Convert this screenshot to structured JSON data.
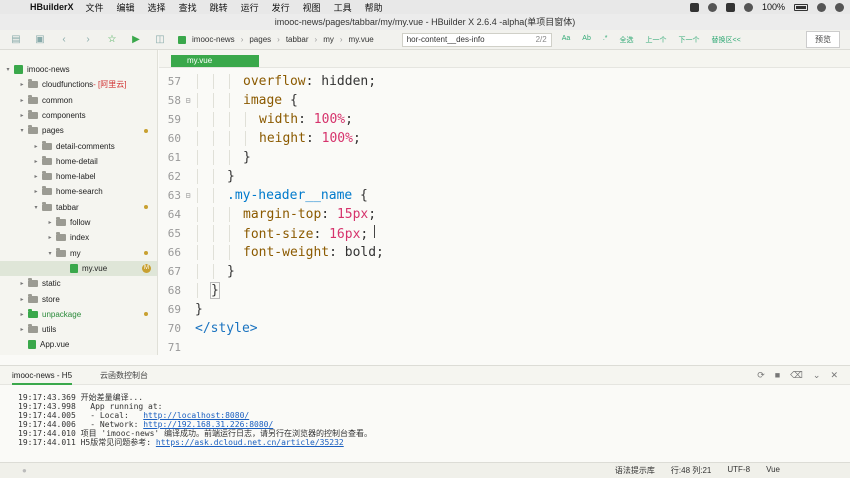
{
  "menubar": {
    "app_name": "HBuilderX",
    "items": [
      "文件",
      "编辑",
      "选择",
      "查找",
      "跳转",
      "运行",
      "发行",
      "视图",
      "工具",
      "帮助"
    ],
    "battery": "100%"
  },
  "window": {
    "title": "imooc-news/pages/tabbar/my/my.vue - HBuilder X 2.6.4 -alpha(单项目窗体)"
  },
  "toolbar": {
    "breadcrumbs": [
      "imooc-news",
      "pages",
      "tabbar",
      "my",
      "my.vue"
    ],
    "find_value": "hor-content__des-info",
    "find_count": "2/2",
    "find_actions": [
      "Aa",
      "Ab",
      ".*",
      "全选",
      "上一个",
      "下一个",
      "替换区<<"
    ],
    "preview_label": "预览"
  },
  "sidebar": {
    "items": [
      {
        "label": "imooc-news",
        "kind": "project",
        "arrow": "▾",
        "indent": 0
      },
      {
        "label": "cloudfunctions",
        "extra": " - [阿里云]",
        "kind": "folder",
        "arrow": "▸",
        "indent": 1
      },
      {
        "label": "common",
        "kind": "folder",
        "arrow": "▸",
        "indent": 1
      },
      {
        "label": "components",
        "kind": "folder",
        "arrow": "▸",
        "indent": 1
      },
      {
        "label": "pages",
        "kind": "folder",
        "arrow": "▾",
        "indent": 1,
        "modified": true
      },
      {
        "label": "detail-comments",
        "kind": "folder",
        "arrow": "▸",
        "indent": 2
      },
      {
        "label": "home-detail",
        "kind": "folder",
        "arrow": "▸",
        "indent": 2
      },
      {
        "label": "home-label",
        "kind": "folder",
        "arrow": "▸",
        "indent": 2
      },
      {
        "label": "home-search",
        "kind": "folder",
        "arrow": "▸",
        "indent": 2
      },
      {
        "label": "tabbar",
        "kind": "folder",
        "arrow": "▾",
        "indent": 2,
        "modified": true
      },
      {
        "label": "follow",
        "kind": "folder",
        "arrow": "▸",
        "indent": 3
      },
      {
        "label": "index",
        "kind": "folder",
        "arrow": "▸",
        "indent": 3
      },
      {
        "label": "my",
        "kind": "folder",
        "arrow": "▾",
        "indent": 3,
        "modified": true
      },
      {
        "label": "my.vue",
        "kind": "file",
        "arrow": "",
        "indent": 4,
        "badge": "M",
        "selected": true
      },
      {
        "label": "static",
        "kind": "folder",
        "arrow": "▸",
        "indent": 1
      },
      {
        "label": "store",
        "kind": "folder",
        "arrow": "▸",
        "indent": 1
      },
      {
        "label": "unpackage",
        "kind": "folder-green",
        "arrow": "▸",
        "indent": 1,
        "modified": true
      },
      {
        "label": "utils",
        "kind": "folder",
        "arrow": "▸",
        "indent": 1
      },
      {
        "label": "App.vue",
        "kind": "file",
        "arrow": "",
        "indent": 1
      }
    ]
  },
  "editor": {
    "tab_label": "my.vue",
    "lines": [
      {
        "n": "57",
        "indent": 3,
        "parts": [
          [
            "prop",
            "overflow"
          ],
          [
            "val",
            ": hidden;"
          ]
        ]
      },
      {
        "n": "58",
        "indent": 3,
        "fold": "⊟",
        "parts": [
          [
            "sel",
            "image"
          ],
          [
            "val",
            " {"
          ]
        ]
      },
      {
        "n": "59",
        "indent": 4,
        "parts": [
          [
            "prop",
            "width"
          ],
          [
            "val",
            ": "
          ],
          [
            "num",
            "100"
          ],
          [
            "unit",
            "%"
          ],
          [
            "val",
            ";"
          ]
        ]
      },
      {
        "n": "60",
        "indent": 4,
        "parts": [
          [
            "prop",
            "height"
          ],
          [
            "val",
            ": "
          ],
          [
            "num",
            "100"
          ],
          [
            "unit",
            "%"
          ],
          [
            "val",
            ";"
          ]
        ]
      },
      {
        "n": "61",
        "indent": 3,
        "parts": [
          [
            "val",
            "}"
          ]
        ]
      },
      {
        "n": "62",
        "indent": 2,
        "parts": [
          [
            "val",
            "}"
          ]
        ]
      },
      {
        "n": "63",
        "indent": 2,
        "fold": "⊟",
        "parts": [
          [
            "cls",
            ".my-header__name"
          ],
          [
            "val",
            " {"
          ]
        ]
      },
      {
        "n": "64",
        "indent": 3,
        "parts": [
          [
            "prop",
            "margin-top"
          ],
          [
            "val",
            ": "
          ],
          [
            "num",
            "15"
          ],
          [
            "unit",
            "px"
          ],
          [
            "val",
            ";"
          ]
        ]
      },
      {
        "n": "65",
        "indent": 3,
        "parts": [
          [
            "prop",
            "font-size"
          ],
          [
            "val",
            ": "
          ],
          [
            "num",
            "16"
          ],
          [
            "unit",
            "px"
          ],
          [
            "val",
            ";"
          ]
        ],
        "cursor": true
      },
      {
        "n": "66",
        "indent": 3,
        "parts": [
          [
            "prop",
            "font-weight"
          ],
          [
            "val",
            ": bold;"
          ]
        ]
      },
      {
        "n": "67",
        "indent": 2,
        "parts": [
          [
            "val",
            "}"
          ]
        ]
      },
      {
        "n": "68",
        "indent": 1,
        "parts": [
          [
            "val",
            "}"
          ]
        ],
        "boxed": true
      },
      {
        "n": "69",
        "indent": 0,
        "parts": [
          [
            "val",
            "}"
          ]
        ]
      },
      {
        "n": "70",
        "indent": 0,
        "parts": [
          [
            "tag",
            "</style>"
          ]
        ]
      },
      {
        "n": "71",
        "indent": 0,
        "parts": []
      }
    ]
  },
  "panel": {
    "tab_main": "imooc-news - H5",
    "tab_secondary": "云函数控制台",
    "console": [
      {
        "text": "19:17:43.369 开始差量编译..."
      },
      {
        "text": "19:17:43.998   App running at:"
      },
      {
        "text": "19:17:44.005   - Local:   ",
        "link": "http://localhost:8080/"
      },
      {
        "text": "19:17:44.006   - Network: ",
        "link": "http://192.168.31.226:8080/"
      },
      {
        "text": "19:17:44.010 项目 'imooc-news' 编译成功。前端运行日志，请另行在浏览器的控制台查看。"
      },
      {
        "text": "19:17:44.011 H5版常见问题参考: ",
        "link": "https://ask.dcloud.net.cn/article/35232"
      }
    ]
  },
  "statusbar": {
    "hint": "语法提示库",
    "position": "行:48  列:21",
    "encoding": "UTF-8",
    "language": "Vue"
  },
  "colors": {
    "accent": "#3aa84b"
  }
}
